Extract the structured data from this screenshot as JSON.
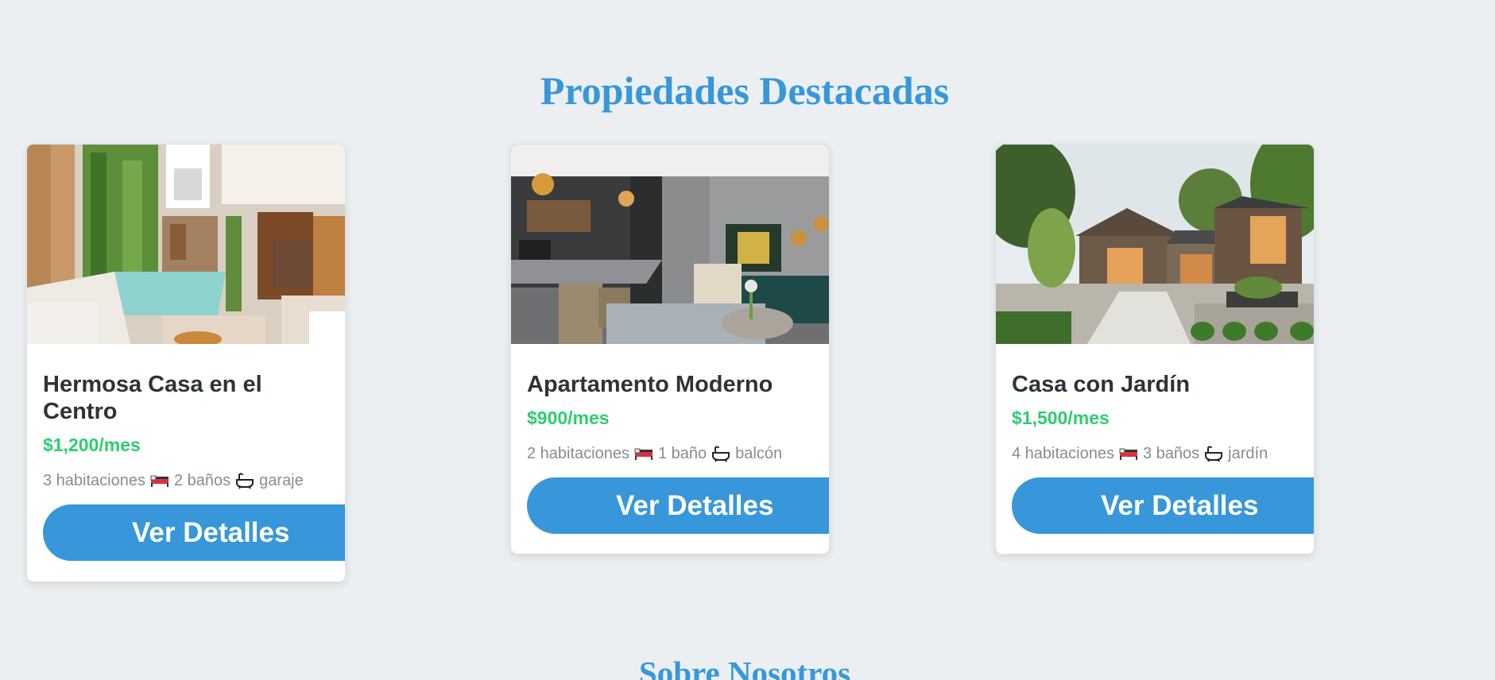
{
  "featured": {
    "title": "Propiedades Destacadas"
  },
  "properties": [
    {
      "title": "Hermosa Casa en el Centro",
      "price": "$1,200/mes",
      "rooms": "3 habitaciones",
      "baths": "2 baños",
      "extra": "garaje",
      "button_label": "Ver Detalles",
      "image_icon": "interior-patio-pool-photo"
    },
    {
      "title": "Apartamento Moderno",
      "price": "$900/mes",
      "rooms": "2 habitaciones",
      "baths": "1 baño",
      "extra": "balcón",
      "button_label": "Ver Detalles",
      "image_icon": "modern-apartment-living-room-photo"
    },
    {
      "title": "Casa con Jardín",
      "price": "$1,500/mes",
      "rooms": "4 habitaciones",
      "baths": "3 baños",
      "extra": "jardín",
      "button_label": "Ver Detalles",
      "image_icon": "house-with-garden-photo"
    }
  ],
  "about": {
    "title": "Sobre Nosotros"
  },
  "colors": {
    "accent": "#3797da",
    "price": "#2ecc71",
    "background": "#ebeff1"
  }
}
